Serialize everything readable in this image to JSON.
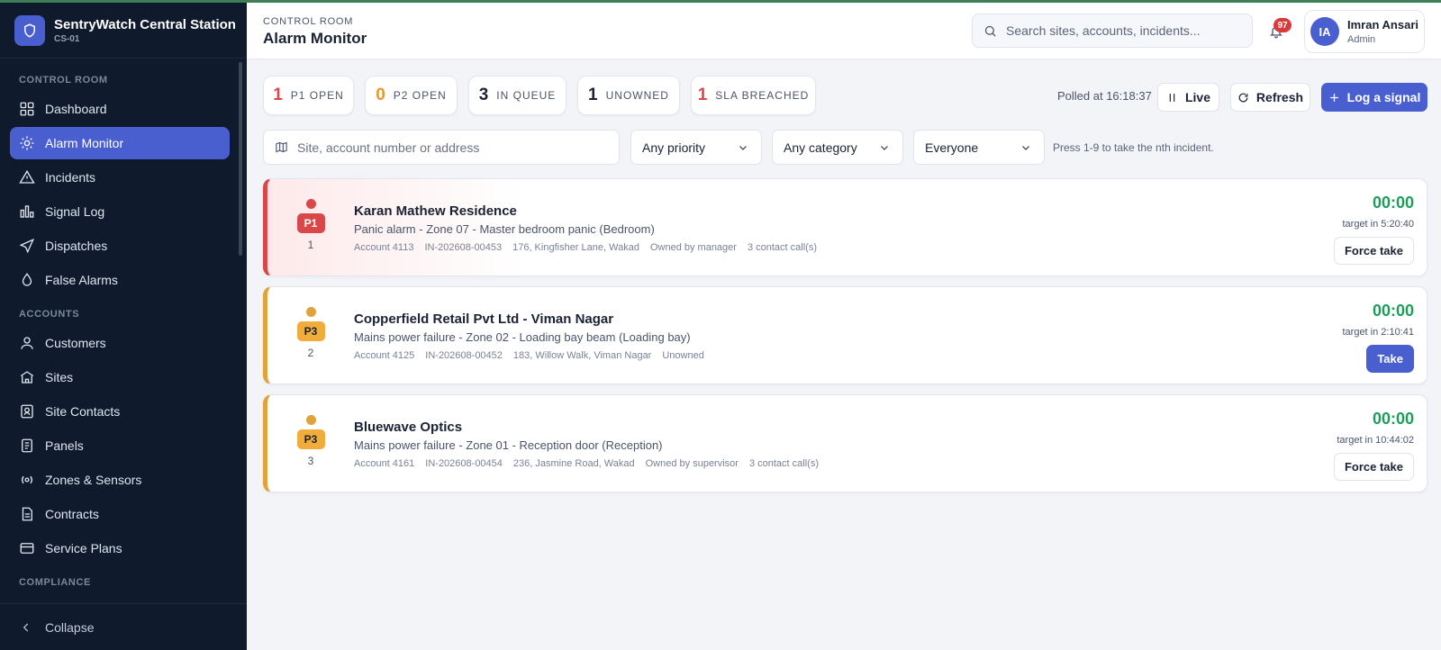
{
  "brand": {
    "title": "SentryWatch Central Station",
    "code": "CS-01"
  },
  "sidebar": {
    "sections": [
      {
        "label": "CONTROL ROOM",
        "items": [
          {
            "label": "Dashboard",
            "icon": "dashboard-icon"
          },
          {
            "label": "Alarm Monitor",
            "icon": "alarm-icon",
            "active": true
          },
          {
            "label": "Incidents",
            "icon": "warning-icon"
          },
          {
            "label": "Signal Log",
            "icon": "bar-chart-icon"
          },
          {
            "label": "Dispatches",
            "icon": "send-icon"
          },
          {
            "label": "False Alarms",
            "icon": "drop-icon"
          }
        ]
      },
      {
        "label": "ACCOUNTS",
        "items": [
          {
            "label": "Customers",
            "icon": "user-icon"
          },
          {
            "label": "Sites",
            "icon": "building-icon"
          },
          {
            "label": "Site Contacts",
            "icon": "contact-icon"
          },
          {
            "label": "Panels",
            "icon": "panel-icon"
          },
          {
            "label": "Zones & Sensors",
            "icon": "sensor-icon"
          },
          {
            "label": "Contracts",
            "icon": "document-icon"
          },
          {
            "label": "Service Plans",
            "icon": "card-icon"
          }
        ]
      },
      {
        "label": "COMPLIANCE",
        "items": []
      }
    ],
    "collapse_label": "Collapse"
  },
  "header": {
    "crumb": "CONTROL ROOM",
    "title": "Alarm Monitor",
    "search_placeholder": "Search sites, accounts, incidents...",
    "notification_count": "97",
    "user": {
      "initials": "IA",
      "name": "Imran Ansari",
      "role": "Admin"
    }
  },
  "stats": [
    {
      "value": "1",
      "label": "P1 OPEN",
      "color": "#d94848"
    },
    {
      "value": "0",
      "label": "P2 OPEN",
      "color": "#e09a2c"
    },
    {
      "value": "3",
      "label": "IN QUEUE",
      "color": "#1b2233"
    },
    {
      "value": "1",
      "label": "UNOWNED",
      "color": "#1b2233"
    },
    {
      "value": "1",
      "label": "SLA BREACHED",
      "color": "#d94848"
    }
  ],
  "toolbar": {
    "polled": "Polled at 16:18:37",
    "live_label": "Live",
    "refresh_label": "Refresh",
    "log_label": "Log a signal"
  },
  "filters": {
    "site_placeholder": "Site, account number or address",
    "priority": "Any priority",
    "category": "Any category",
    "owner": "Everyone",
    "hint": "Press 1-9 to take the nth incident."
  },
  "incidents": [
    {
      "priority": "P1",
      "rank": "1",
      "color": "#d94848",
      "title": "Karan Mathew Residence",
      "description": "Panic alarm - Zone 07 - Master bedroom panic (Bedroom)",
      "account": "Account 4113",
      "incident_id": "IN-202608-00453",
      "address": "176, Kingfisher Lane, Wakad",
      "owner": "Owned by manager",
      "calls": "3 contact call(s)",
      "timer": "00:00",
      "target": "target in 5:20:40",
      "action": "Force take"
    },
    {
      "priority": "P3",
      "rank": "2",
      "color": "#e0a33a",
      "title": "Copperfield Retail Pvt Ltd - Viman Nagar",
      "description": "Mains power failure - Zone 02 - Loading bay beam (Loading bay)",
      "account": "Account 4125",
      "incident_id": "IN-202608-00452",
      "address": "183, Willow Walk, Viman Nagar",
      "owner": "Unowned",
      "calls": "",
      "timer": "00:00",
      "target": "target in 2:10:41",
      "action": "Take"
    },
    {
      "priority": "P3",
      "rank": "3",
      "color": "#e0a33a",
      "title": "Bluewave Optics",
      "description": "Mains power failure - Zone 01 - Reception door (Reception)",
      "account": "Account 4161",
      "incident_id": "IN-202608-00454",
      "address": "236, Jasmine Road, Wakad",
      "owner": "Owned by supervisor",
      "calls": "3 contact call(s)",
      "timer": "00:00",
      "target": "target in 10:44:02",
      "action": "Force take"
    }
  ]
}
